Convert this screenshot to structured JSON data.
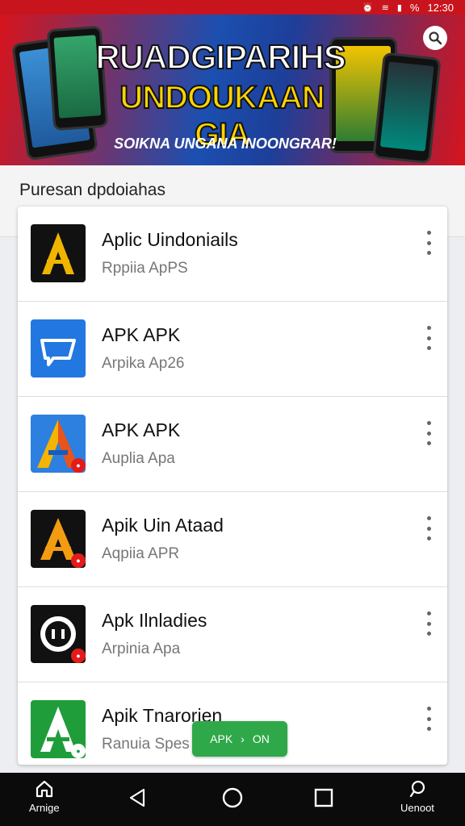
{
  "status_bar": {
    "time": "12:30",
    "battery": "%"
  },
  "banner": {
    "title": "RUADGIPARIHS",
    "subtitle": "UNDOUKAAN GIA",
    "tagline": "SOIKNA UNGANA INOONGRAR!"
  },
  "section": {
    "title": "Puresan dpdoiahas"
  },
  "apps": [
    {
      "name": "Aplic Uindoniails",
      "sub": "Rppiia ApPS",
      "icon": "gold-a-icon"
    },
    {
      "name": "APK APK",
      "sub": "Arpika Ap26",
      "icon": "blue-tag-icon"
    },
    {
      "name": "APK APK",
      "sub": "Auplia Apa",
      "icon": "color-a-icon"
    },
    {
      "name": "Apik Uin Ataad",
      "sub": "Aqpiia APR",
      "icon": "gold-a-icon"
    },
    {
      "name": "Apk Ilnladies",
      "sub": "Arpinia Apa",
      "icon": "face-icon"
    },
    {
      "name": "Apik Tnarorien",
      "sub": "Ranuia Spes",
      "icon": "green-a-icon"
    }
  ],
  "install_button": {
    "label_left": "APK",
    "label_right": "ON"
  },
  "nav": {
    "home_label": "Arnige",
    "right_label": "Uenoot"
  },
  "colors": {
    "status_red": "#c8141c",
    "install_green": "#2fa84a"
  }
}
